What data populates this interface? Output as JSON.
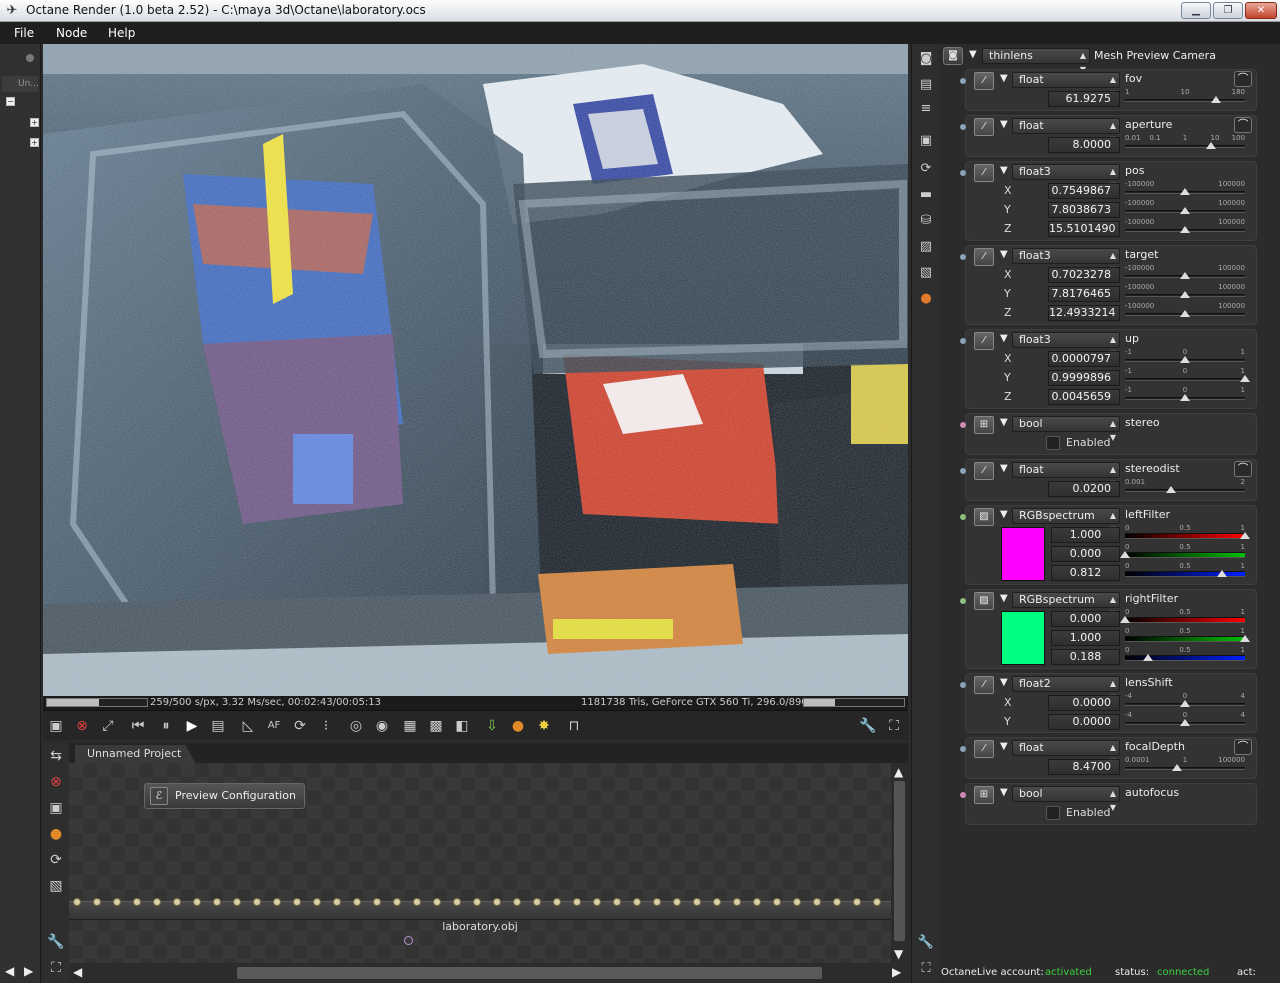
{
  "window": {
    "title": "Octane Render (1.0 beta 2.52) - C:\\maya 3d\\Octane\\laboratory.ocs"
  },
  "menu": [
    "File",
    "Node",
    "Help"
  ],
  "left": {
    "tab_label": "Un..."
  },
  "status": {
    "samples_progress": 0.518,
    "info": "259/500 s/px, 3.32 Ms/sec, 00:02:43/00:05:13",
    "gpu_info": "1181738 Tris, GeForce GTX 560 Ti, 296.0/890/961 MB",
    "memory_progress": 0.308
  },
  "node_editor": {
    "tab": "Unnamed Project",
    "preview_node": "Preview Configuration",
    "mesh_node": "laboratory.obj"
  },
  "camera": {
    "type": "thinlens",
    "name": "Mesh Preview Camera",
    "params": [
      {
        "name": "fov",
        "type": "float",
        "value": "61.9275",
        "ticks": [
          "1",
          "10",
          "180"
        ],
        "pos": 0.76,
        "curve": true
      },
      {
        "name": "aperture",
        "type": "float",
        "value": "8.0000",
        "ticks": [
          "0.01",
          "0.1",
          "1",
          "10",
          "100"
        ],
        "pos": 0.72,
        "curve": true
      },
      {
        "name": "pos",
        "type": "float3",
        "axes": [
          {
            "axis": "X",
            "value": "0.7549867",
            "min": "-100000",
            "max": "100000",
            "pos": 0.5
          },
          {
            "axis": "Y",
            "value": "7.8038673",
            "min": "-100000",
            "max": "100000",
            "pos": 0.5
          },
          {
            "axis": "Z",
            "value": "15.5101490",
            "min": "-100000",
            "max": "100000",
            "pos": 0.5
          }
        ]
      },
      {
        "name": "target",
        "type": "float3",
        "axes": [
          {
            "axis": "X",
            "value": "0.7023278",
            "min": "-100000",
            "max": "100000",
            "pos": 0.5
          },
          {
            "axis": "Y",
            "value": "7.8176465",
            "min": "-100000",
            "max": "100000",
            "pos": 0.5
          },
          {
            "axis": "Z",
            "value": "12.4933214",
            "min": "-100000",
            "max": "100000",
            "pos": 0.5
          }
        ]
      },
      {
        "name": "up",
        "type": "float3",
        "axes": [
          {
            "axis": "X",
            "value": "0.0000797",
            "min": "-1",
            "mid": "0",
            "max": "1",
            "pos": 0.5
          },
          {
            "axis": "Y",
            "value": "0.9999896",
            "min": "-1",
            "mid": "0",
            "max": "1",
            "pos": 1.0
          },
          {
            "axis": "Z",
            "value": "0.0045659",
            "min": "-1",
            "mid": "0",
            "max": "1",
            "pos": 0.5
          }
        ]
      },
      {
        "name": "stereo",
        "type": "bool",
        "checkbox": "Enabled",
        "checked": false
      },
      {
        "name": "stereodist",
        "type": "float",
        "value": "0.0200",
        "ticks": [
          "0.001",
          "2"
        ],
        "pos": 0.38,
        "curve": true
      },
      {
        "name": "leftFilter",
        "type": "RGBspectrum",
        "swatch": "#ff00ff",
        "channels": [
          {
            "value": "1.000",
            "pos": 1.0,
            "color": "#ff0000"
          },
          {
            "value": "0.000",
            "pos": 0.0,
            "color": "#00c000"
          },
          {
            "value": "0.812",
            "pos": 0.81,
            "color": "#0020ff"
          }
        ],
        "ticks": [
          "0",
          "0.5",
          "1"
        ]
      },
      {
        "name": "rightFilter",
        "type": "RGBspectrum",
        "swatch": "#00ff80",
        "channels": [
          {
            "value": "0.000",
            "pos": 0.0,
            "color": "#ff0000"
          },
          {
            "value": "1.000",
            "pos": 1.0,
            "color": "#00c000"
          },
          {
            "value": "0.188",
            "pos": 0.19,
            "color": "#0020ff"
          }
        ],
        "ticks": [
          "0",
          "0.5",
          "1"
        ]
      },
      {
        "name": "lensShift",
        "type": "float2",
        "axes": [
          {
            "axis": "X",
            "value": "0.0000",
            "min": "-4",
            "mid": "0",
            "max": "4",
            "pos": 0.5
          },
          {
            "axis": "Y",
            "value": "0.0000",
            "min": "-4",
            "mid": "0",
            "max": "4",
            "pos": 0.5
          }
        ]
      },
      {
        "name": "focalDepth",
        "type": "float",
        "value": "8.4700",
        "ticks": [
          "0.0001",
          "1",
          "100000"
        ],
        "pos": 0.43,
        "curve": true
      },
      {
        "name": "autofocus",
        "type": "bool",
        "checkbox": "Enabled",
        "checked": false
      }
    ]
  },
  "footer": {
    "account_label": "OctaneLive account:",
    "account_value": "activated",
    "status_label": "status:",
    "status_value": "connected",
    "act_label": "act:"
  }
}
